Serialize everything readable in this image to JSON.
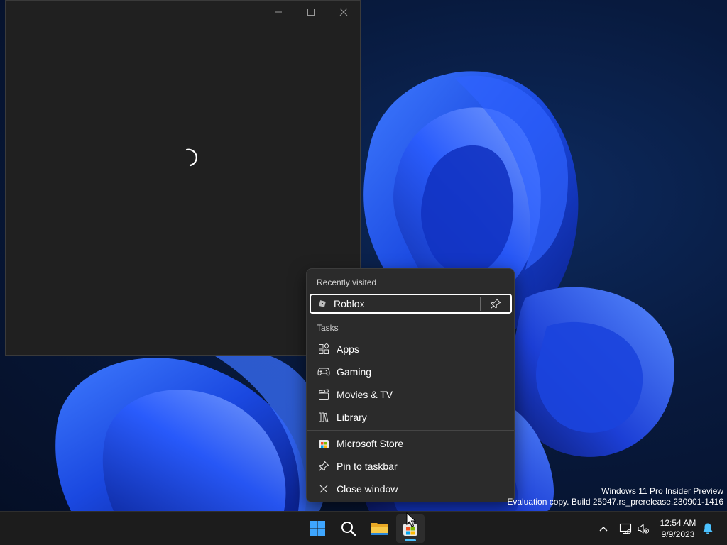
{
  "window": {
    "caption": {
      "minimize_icon": "minimize-icon",
      "maximize_icon": "maximize-icon",
      "close_icon": "close-icon"
    },
    "state": "loading"
  },
  "jumplist": {
    "recent_header": "Recently visited",
    "recent_items": [
      {
        "label": "Roblox",
        "icon": "roblox-icon",
        "action_icon": "pin-icon"
      }
    ],
    "tasks_header": "Tasks",
    "tasks": [
      {
        "label": "Apps",
        "icon": "apps-icon"
      },
      {
        "label": "Gaming",
        "icon": "gamepad-icon"
      },
      {
        "label": "Movies & TV",
        "icon": "clapperboard-icon"
      },
      {
        "label": "Library",
        "icon": "library-icon"
      }
    ],
    "actions": [
      {
        "label": "Microsoft Store",
        "icon": "microsoft-store-icon"
      },
      {
        "label": "Pin to taskbar",
        "icon": "pin-icon"
      },
      {
        "label": "Close window",
        "icon": "close-icon"
      }
    ]
  },
  "watermark": {
    "line1": "Windows 11 Pro Insider Preview",
    "line2": "Evaluation copy. Build 25947.rs_prerelease.230901-1416"
  },
  "taskbar": {
    "apps": [
      {
        "icon": "start-icon"
      },
      {
        "icon": "search-icon"
      },
      {
        "icon": "file-explorer-icon"
      },
      {
        "icon": "microsoft-store-icon",
        "active": true
      }
    ],
    "tray": {
      "icons": [
        "chevron-up-icon",
        "network-icon",
        "volume-muted-icon"
      ],
      "time": "12:54 AM",
      "date": "9/9/2023",
      "notification_icon": "bell-icon"
    }
  },
  "colors": {
    "accent": "#4cc2ff",
    "flyout_bg": "#2b2b2b",
    "window_bg": "#202020",
    "taskbar_bg": "#1c1c1c"
  }
}
